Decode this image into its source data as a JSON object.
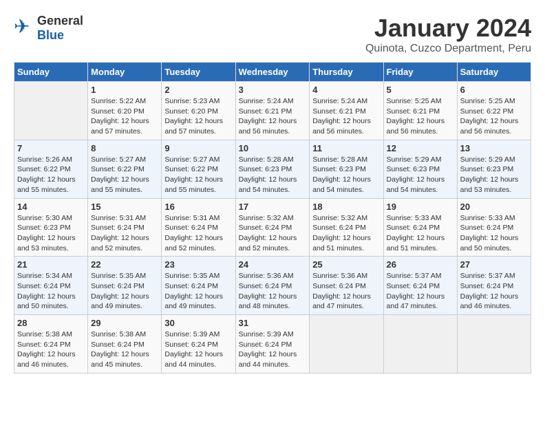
{
  "header": {
    "logo_general": "General",
    "logo_blue": "Blue",
    "month_year": "January 2024",
    "location": "Quinota, Cuzco Department, Peru"
  },
  "days_of_week": [
    "Sunday",
    "Monday",
    "Tuesday",
    "Wednesday",
    "Thursday",
    "Friday",
    "Saturday"
  ],
  "weeks": [
    [
      {
        "day": "",
        "info": ""
      },
      {
        "day": "1",
        "info": "Sunrise: 5:22 AM\nSunset: 6:20 PM\nDaylight: 12 hours\nand 57 minutes."
      },
      {
        "day": "2",
        "info": "Sunrise: 5:23 AM\nSunset: 6:20 PM\nDaylight: 12 hours\nand 57 minutes."
      },
      {
        "day": "3",
        "info": "Sunrise: 5:24 AM\nSunset: 6:21 PM\nDaylight: 12 hours\nand 56 minutes."
      },
      {
        "day": "4",
        "info": "Sunrise: 5:24 AM\nSunset: 6:21 PM\nDaylight: 12 hours\nand 56 minutes."
      },
      {
        "day": "5",
        "info": "Sunrise: 5:25 AM\nSunset: 6:21 PM\nDaylight: 12 hours\nand 56 minutes."
      },
      {
        "day": "6",
        "info": "Sunrise: 5:25 AM\nSunset: 6:22 PM\nDaylight: 12 hours\nand 56 minutes."
      }
    ],
    [
      {
        "day": "7",
        "info": "Sunrise: 5:26 AM\nSunset: 6:22 PM\nDaylight: 12 hours\nand 55 minutes."
      },
      {
        "day": "8",
        "info": "Sunrise: 5:27 AM\nSunset: 6:22 PM\nDaylight: 12 hours\nand 55 minutes."
      },
      {
        "day": "9",
        "info": "Sunrise: 5:27 AM\nSunset: 6:22 PM\nDaylight: 12 hours\nand 55 minutes."
      },
      {
        "day": "10",
        "info": "Sunrise: 5:28 AM\nSunset: 6:23 PM\nDaylight: 12 hours\nand 54 minutes."
      },
      {
        "day": "11",
        "info": "Sunrise: 5:28 AM\nSunset: 6:23 PM\nDaylight: 12 hours\nand 54 minutes."
      },
      {
        "day": "12",
        "info": "Sunrise: 5:29 AM\nSunset: 6:23 PM\nDaylight: 12 hours\nand 54 minutes."
      },
      {
        "day": "13",
        "info": "Sunrise: 5:29 AM\nSunset: 6:23 PM\nDaylight: 12 hours\nand 53 minutes."
      }
    ],
    [
      {
        "day": "14",
        "info": "Sunrise: 5:30 AM\nSunset: 6:23 PM\nDaylight: 12 hours\nand 53 minutes."
      },
      {
        "day": "15",
        "info": "Sunrise: 5:31 AM\nSunset: 6:24 PM\nDaylight: 12 hours\nand 52 minutes."
      },
      {
        "day": "16",
        "info": "Sunrise: 5:31 AM\nSunset: 6:24 PM\nDaylight: 12 hours\nand 52 minutes."
      },
      {
        "day": "17",
        "info": "Sunrise: 5:32 AM\nSunset: 6:24 PM\nDaylight: 12 hours\nand 52 minutes."
      },
      {
        "day": "18",
        "info": "Sunrise: 5:32 AM\nSunset: 6:24 PM\nDaylight: 12 hours\nand 51 minutes."
      },
      {
        "day": "19",
        "info": "Sunrise: 5:33 AM\nSunset: 6:24 PM\nDaylight: 12 hours\nand 51 minutes."
      },
      {
        "day": "20",
        "info": "Sunrise: 5:33 AM\nSunset: 6:24 PM\nDaylight: 12 hours\nand 50 minutes."
      }
    ],
    [
      {
        "day": "21",
        "info": "Sunrise: 5:34 AM\nSunset: 6:24 PM\nDaylight: 12 hours\nand 50 minutes."
      },
      {
        "day": "22",
        "info": "Sunrise: 5:35 AM\nSunset: 6:24 PM\nDaylight: 12 hours\nand 49 minutes."
      },
      {
        "day": "23",
        "info": "Sunrise: 5:35 AM\nSunset: 6:24 PM\nDaylight: 12 hours\nand 49 minutes."
      },
      {
        "day": "24",
        "info": "Sunrise: 5:36 AM\nSunset: 6:24 PM\nDaylight: 12 hours\nand 48 minutes."
      },
      {
        "day": "25",
        "info": "Sunrise: 5:36 AM\nSunset: 6:24 PM\nDaylight: 12 hours\nand 47 minutes."
      },
      {
        "day": "26",
        "info": "Sunrise: 5:37 AM\nSunset: 6:24 PM\nDaylight: 12 hours\nand 47 minutes."
      },
      {
        "day": "27",
        "info": "Sunrise: 5:37 AM\nSunset: 6:24 PM\nDaylight: 12 hours\nand 46 minutes."
      }
    ],
    [
      {
        "day": "28",
        "info": "Sunrise: 5:38 AM\nSunset: 6:24 PM\nDaylight: 12 hours\nand 46 minutes."
      },
      {
        "day": "29",
        "info": "Sunrise: 5:38 AM\nSunset: 6:24 PM\nDaylight: 12 hours\nand 45 minutes."
      },
      {
        "day": "30",
        "info": "Sunrise: 5:39 AM\nSunset: 6:24 PM\nDaylight: 12 hours\nand 44 minutes."
      },
      {
        "day": "31",
        "info": "Sunrise: 5:39 AM\nSunset: 6:24 PM\nDaylight: 12 hours\nand 44 minutes."
      },
      {
        "day": "",
        "info": ""
      },
      {
        "day": "",
        "info": ""
      },
      {
        "day": "",
        "info": ""
      }
    ]
  ]
}
